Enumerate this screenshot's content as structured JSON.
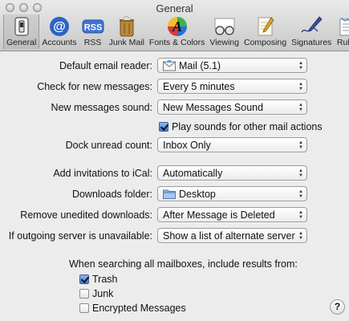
{
  "window": {
    "title": "General"
  },
  "toolbar": {
    "items": [
      {
        "label": "General",
        "icon": "general-switch-icon",
        "selected": true
      },
      {
        "label": "Accounts",
        "icon": "at-sign-icon"
      },
      {
        "label": "RSS",
        "icon": "rss-icon"
      },
      {
        "label": "Junk Mail",
        "icon": "trash-can-icon"
      },
      {
        "label": "Fonts & Colors",
        "icon": "fonts-colors-icon"
      },
      {
        "label": "Viewing",
        "icon": "glasses-icon"
      },
      {
        "label": "Composing",
        "icon": "pen-paper-icon"
      },
      {
        "label": "Signatures",
        "icon": "signature-pen-icon"
      },
      {
        "label": "Rules",
        "icon": "rules-icon"
      }
    ],
    "rss_text": "RSS",
    "at_text": "@",
    "fonts_text": "A"
  },
  "settings": {
    "default_reader": {
      "label": "Default email reader:",
      "value": "Mail (5.1)"
    },
    "check_messages": {
      "label": "Check for new messages:",
      "value": "Every 5 minutes"
    },
    "new_sound": {
      "label": "New messages sound:",
      "value": "New Messages Sound"
    },
    "play_sounds": {
      "label": "Play sounds for other mail actions",
      "checked": true
    },
    "dock_count": {
      "label": "Dock unread count:",
      "value": "Inbox Only"
    },
    "ical": {
      "label": "Add invitations to iCal:",
      "value": "Automatically"
    },
    "downloads": {
      "label": "Downloads folder:",
      "value": "Desktop"
    },
    "remove_downloads": {
      "label": "Remove unedited downloads:",
      "value": "After Message is Deleted"
    },
    "outgoing": {
      "label": "If outgoing server is unavailable:",
      "value": "Show a list of alternate servers"
    }
  },
  "search": {
    "heading": "When searching all mailboxes, include results from:",
    "options": [
      {
        "label": "Trash",
        "checked": true
      },
      {
        "label": "Junk",
        "checked": false
      },
      {
        "label": "Encrypted Messages",
        "checked": false
      }
    ]
  },
  "help": {
    "label": "?"
  },
  "colors": {
    "accent": "#3b79d4",
    "background": "#ececec"
  }
}
